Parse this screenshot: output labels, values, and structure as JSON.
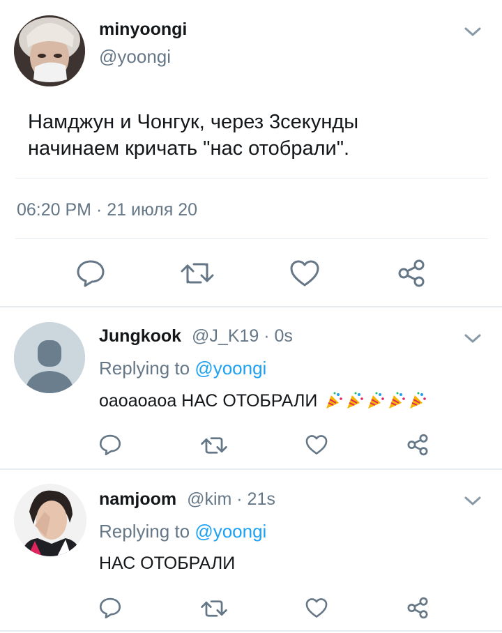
{
  "main_tweet": {
    "display_name": "minyoongi",
    "handle": "@yoongi",
    "text_line1": "Намджун и Чонгук, через 3секунды",
    "text_line2": "начинаем кричать \"нас отобрали\".",
    "timestamp": "06:20 PM · 21 июля 20"
  },
  "replies": [
    {
      "display_name": "Jungkook",
      "handle_time": "@J_K19 · 0s",
      "replying_label": "Replying to",
      "replying_handle": "@yoongi",
      "text": "оаоаоаоа НАС ОТОБРАЛИ"
    },
    {
      "display_name": "namjoom",
      "handle_time": "@kim · 21s",
      "replying_label": "Replying to",
      "replying_handle": "@yoongi",
      "text": "НАС ОТОБРАЛИ"
    }
  ],
  "icons": [
    "reply-icon",
    "retweet-icon",
    "like-icon",
    "share-icon",
    "chevron-down-icon",
    "party-popper-icon"
  ],
  "colors": {
    "text": "#14171a",
    "secondary": "#657786",
    "link": "#1da1f2",
    "divider": "#e6ecf0"
  }
}
